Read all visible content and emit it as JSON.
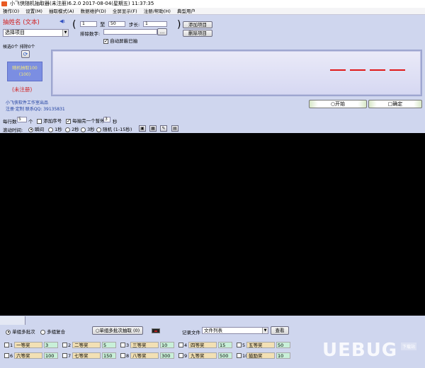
{
  "window": {
    "title": "小飞侠随机抽取器(未注册)6.2.0 2017-08-04(星期五) 11:37:35"
  },
  "menu": [
    "操作(O)",
    "设置(M)",
    "抽取模式(A)",
    "数据维护(D)",
    "全屏显示(F)",
    "注册/帮助(H)",
    "典型用户"
  ],
  "top": {
    "list_title": "抽姓名 (文本)",
    "select_value": "选择项目",
    "range_from": "1",
    "range_to_label": "至",
    "range_to": "50",
    "step_label": "步长:",
    "step_value": "1",
    "exclude_label": "排除数字:",
    "exclude_value": "",
    "auto_exclude_label": "自动屏蔽已抽",
    "add_item_btn": "添加项目",
    "delete_item_btn": "删除项目",
    "status_text": "候选0个 排除0个",
    "logo_line1": "随机抽取100",
    "logo_line2": "(100)",
    "unregistered": "(未注册)",
    "studio": "小飞侠软件工作室出品",
    "contact": "注册·定制 联系QQ: 39135831",
    "start_btn": "○开始",
    "confirm_btn": "□确定"
  },
  "options": {
    "per_row_label": "每行数",
    "per_row_value": "5",
    "per_row_unit": "个",
    "add_seq_label": "添加序号",
    "pause_label": "每抽完一个暂停",
    "pause_value": "3",
    "pause_unit": "秒",
    "scroll_label": "滚动时间:",
    "scroll_options": [
      "瞬间",
      "1秒",
      "2秒",
      "3秒",
      "随机 (1-15秒)"
    ]
  },
  "bottom": {
    "single_batch": "单组多批次",
    "multi_merge": "多组复合",
    "single_group_btn": "○单组多批次抽取 (0)",
    "record_label": "记录文件",
    "record_value": "文件列表",
    "view_btn": "查看",
    "prizes": [
      {
        "num": "1",
        "name": "一等奖",
        "count": "3"
      },
      {
        "num": "2",
        "name": "二等奖",
        "count": "5"
      },
      {
        "num": "3",
        "name": "三等奖",
        "count": "10"
      },
      {
        "num": "4",
        "name": "四等奖",
        "count": "15"
      },
      {
        "num": "5",
        "name": "五等奖",
        "count": "50"
      },
      {
        "num": "6",
        "name": "六等奖",
        "count": "100"
      },
      {
        "num": "7",
        "name": "七等奖",
        "count": "150"
      },
      {
        "num": "8",
        "name": "八等奖",
        "count": "300"
      },
      {
        "num": "9",
        "name": "九等奖",
        "count": "500"
      },
      {
        "num": "10",
        "name": "鼓励奖",
        "count": "10"
      }
    ]
  },
  "watermark": "UEBUG",
  "watermark_sub": "下载站"
}
